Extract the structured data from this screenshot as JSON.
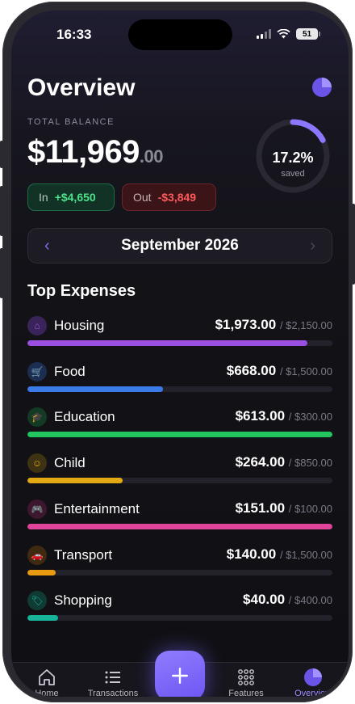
{
  "status": {
    "time": "16:33",
    "battery": "51"
  },
  "header": {
    "title": "Overview",
    "chart_icon": "pie-chart-icon"
  },
  "balance": {
    "label": "TOTAL BALANCE",
    "amount": "$11,969",
    "cents": ".00",
    "in_label": "In",
    "in_value": "+$4,650",
    "out_label": "Out",
    "out_value": "-$3,849",
    "saved_pct": "17.2%",
    "saved_fraction": 0.172,
    "saved_label": "saved"
  },
  "month": {
    "label": "September 2026",
    "prev_icon": "chevron-left-icon",
    "next_icon": "chevron-right-icon"
  },
  "expenses": {
    "title": "Top Expenses",
    "items": [
      {
        "name": "Housing",
        "amount": "$1,973.00",
        "budget": "/ $2,150.00",
        "progress": 0.918,
        "color": "#9b4fe0",
        "icon": "house-icon",
        "glyph": "⌂",
        "icon_bg": "#3a2358"
      },
      {
        "name": "Food",
        "amount": "$668.00",
        "budget": "/ $1,500.00",
        "progress": 0.445,
        "color": "#3a7be8",
        "icon": "cart-icon",
        "glyph": "🛒",
        "icon_bg": "#1c2d52"
      },
      {
        "name": "Education",
        "amount": "$613.00",
        "budget": "/ $300.00",
        "progress": 1.0,
        "color": "#22c55e",
        "icon": "graduation-cap-icon",
        "glyph": "🎓",
        "icon_bg": "#143a24"
      },
      {
        "name": "Child",
        "amount": "$264.00",
        "budget": "/ $850.00",
        "progress": 0.311,
        "color": "#e3a913",
        "icon": "smiley-icon",
        "glyph": "☺",
        "icon_bg": "#3d3212"
      },
      {
        "name": "Entertainment",
        "amount": "$151.00",
        "budget": "/ $100.00",
        "progress": 1.0,
        "color": "#e0449a",
        "icon": "gamepad-icon",
        "glyph": "🎮",
        "icon_bg": "#3d1730"
      },
      {
        "name": "Transport",
        "amount": "$140.00",
        "budget": "/ $1,500.00",
        "progress": 0.093,
        "color": "#e89a10",
        "icon": "car-icon",
        "glyph": "🚗",
        "icon_bg": "#3d2a10"
      },
      {
        "name": "Shopping",
        "amount": "$40.00",
        "budget": "/ $400.00",
        "progress": 0.1,
        "color": "#17b39a",
        "icon": "tag-icon",
        "glyph": "🏷",
        "icon_bg": "#103a34"
      }
    ]
  },
  "tabs": [
    {
      "label": "Home",
      "icon": "home-icon"
    },
    {
      "label": "Transactions",
      "icon": "list-icon"
    },
    {
      "label": "Features",
      "icon": "grid-icon"
    },
    {
      "label": "Overview",
      "icon": "pie-chart-icon",
      "active": true
    }
  ],
  "fab": {
    "icon": "plus-icon"
  }
}
